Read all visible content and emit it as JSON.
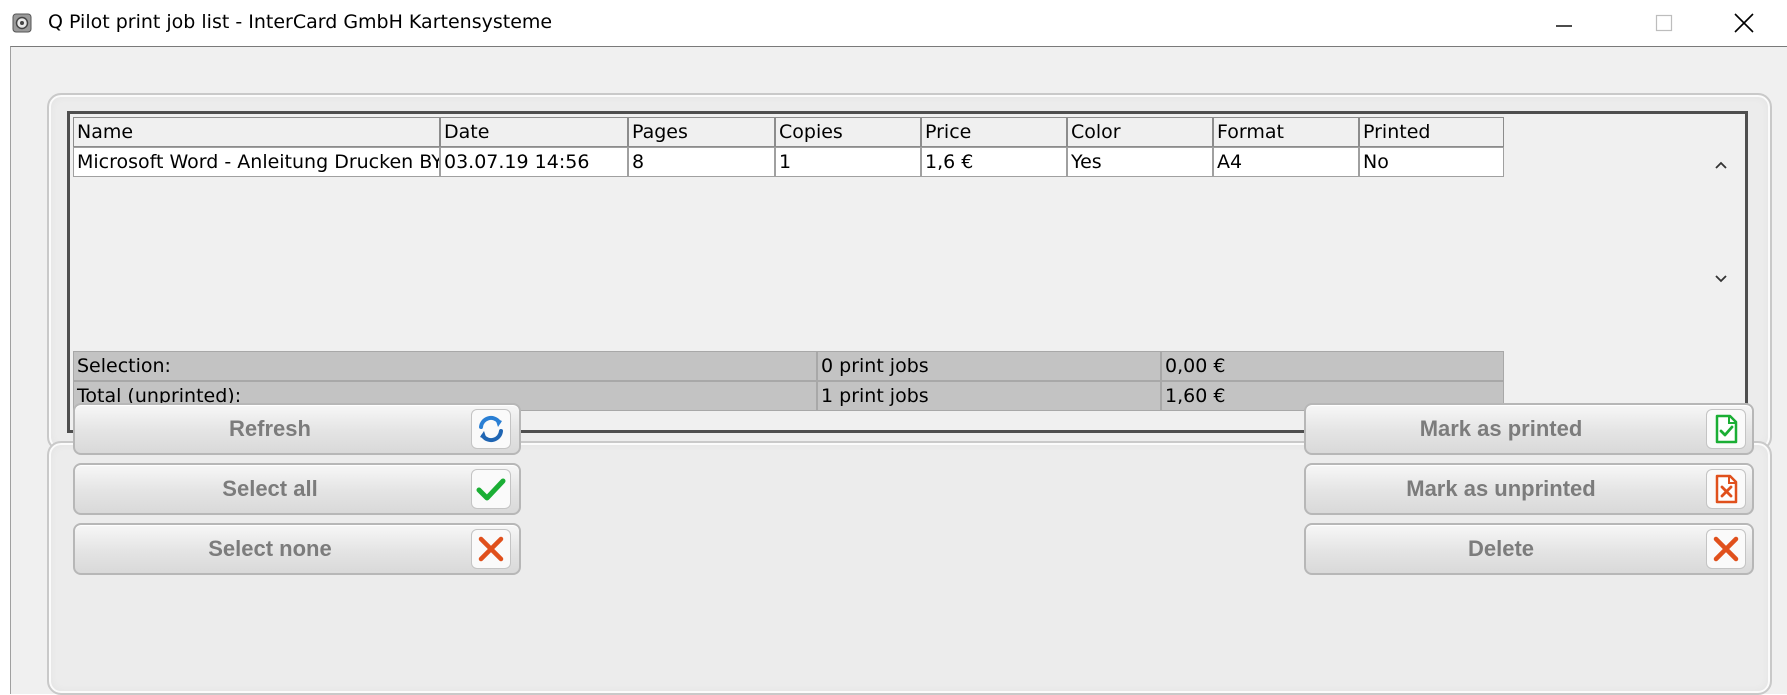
{
  "window": {
    "title": "Q Pilot print job list - InterCard GmbH Kartensysteme"
  },
  "table": {
    "columns": [
      "Name",
      "Date",
      "Pages",
      "Copies",
      "Price",
      "Color",
      "Format",
      "Printed"
    ],
    "rows": [
      [
        "Microsoft Word - Anleitung Drucken BYO...",
        "03.07.19 14:56",
        "8",
        "1",
        "1,6 €",
        "Yes",
        "A4",
        "No"
      ]
    ],
    "summary": [
      {
        "label": "Selection:",
        "count": "0 print jobs",
        "amount": "0,00 €"
      },
      {
        "label": "Total (unprinted):",
        "count": "1 print jobs",
        "amount": "1,60 €"
      }
    ]
  },
  "buttons": {
    "refresh": "Refresh",
    "select_all": "Select all",
    "select_none": "Select none",
    "mark_printed": "Mark as printed",
    "mark_unprinted": "Mark as unprinted",
    "delete": "Delete"
  },
  "icons": {
    "refresh": "refresh-icon",
    "select_all": "checkmark-icon",
    "select_none": "cross-icon",
    "mark_printed": "document-check-icon",
    "mark_unprinted": "document-cross-icon",
    "delete": "cross-icon"
  },
  "colors": {
    "refresh_blue": "#2a7fd4",
    "check_green": "#1aae34",
    "cross_orange": "#e0501c",
    "summary_gray": "#c3c3c3",
    "button_text": "#7c7c7c"
  }
}
